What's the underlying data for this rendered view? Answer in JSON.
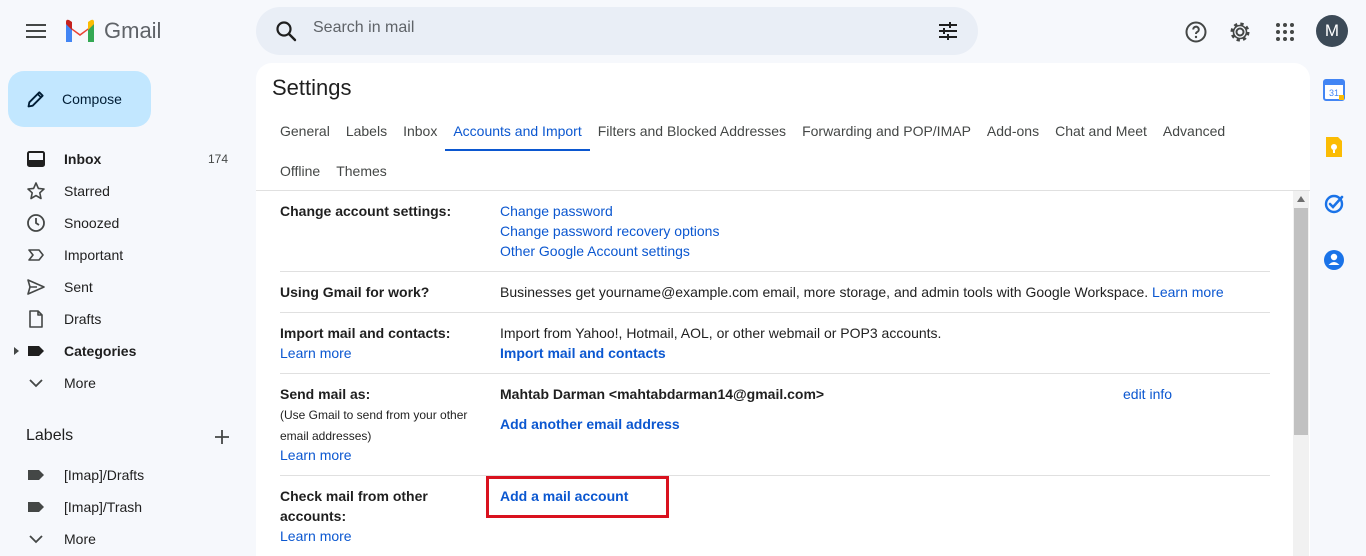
{
  "app": {
    "name": "Gmail"
  },
  "search": {
    "placeholder": "Search in mail"
  },
  "user": {
    "avatar_letter": "M"
  },
  "colors": {
    "accent": "#0b57d0",
    "compose_bg": "#c2e7ff",
    "highlight": "#d9111e",
    "avatar": "#3c4a57"
  },
  "compose": {
    "label": "Compose"
  },
  "nav": [
    {
      "label": "Inbox",
      "count": "174",
      "icon": "inbox-icon"
    },
    {
      "label": "Starred",
      "count": "",
      "icon": "star-icon"
    },
    {
      "label": "Snoozed",
      "count": "",
      "icon": "clock-icon"
    },
    {
      "label": "Important",
      "count": "",
      "icon": "important-icon"
    },
    {
      "label": "Sent",
      "count": "",
      "icon": "send-icon"
    },
    {
      "label": "Drafts",
      "count": "",
      "icon": "draft-icon"
    },
    {
      "label": "Categories",
      "count": "",
      "icon": "label-icon"
    },
    {
      "label": "More",
      "count": "",
      "icon": "chevron-down-icon"
    }
  ],
  "labels": {
    "title": "Labels",
    "items": [
      {
        "label": "[Imap]/Drafts"
      },
      {
        "label": "[Imap]/Trash"
      },
      {
        "label": "More"
      }
    ]
  },
  "settings": {
    "title": "Settings",
    "tabs_row1": [
      "General",
      "Labels",
      "Inbox",
      "Accounts and Import",
      "Filters and Blocked Addresses",
      "Forwarding and POP/IMAP",
      "Add-ons",
      "Chat and Meet",
      "Advanced"
    ],
    "tabs_row2": [
      "Offline",
      "Themes"
    ],
    "active_tab": "Accounts and Import",
    "rows": {
      "change_account": {
        "label": "Change account settings:",
        "links": [
          "Change password",
          "Change password recovery options",
          "Other Google Account settings"
        ]
      },
      "gmail_work": {
        "label": "Using Gmail for work?",
        "text": "Businesses get yourname@example.com email, more storage, and admin tools with Google Workspace.",
        "link": "Learn more"
      },
      "import": {
        "label": "Import mail and contacts:",
        "learn_more": "Learn more",
        "text": "Import from Yahoo!, Hotmail, AOL, or other webmail or POP3 accounts.",
        "action": "Import mail and contacts"
      },
      "send_as": {
        "label": "Send mail as:",
        "sub1": "(Use Gmail to send from your other",
        "sub2": "email addresses)",
        "learn_more": "Learn more",
        "address": "Mahtab Darman <mahtabdarman14@gmail.com>",
        "edit": "edit info",
        "action": "Add another email address"
      },
      "check_mail": {
        "label1": "Check mail from other",
        "label2": "accounts:",
        "learn_more": "Learn more",
        "action": "Add a mail account"
      }
    }
  }
}
